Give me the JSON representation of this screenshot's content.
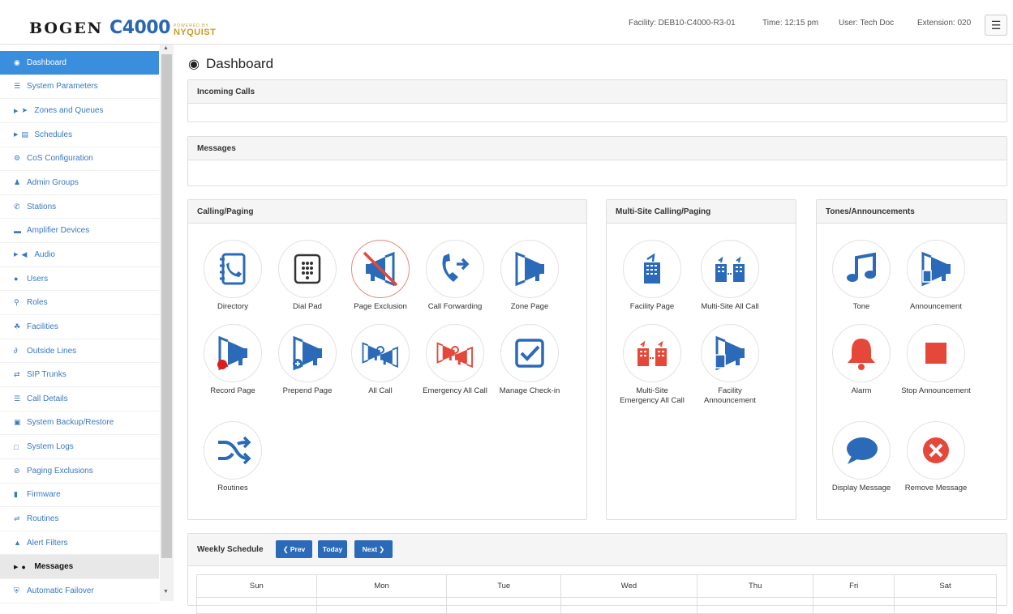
{
  "header": {
    "logo": {
      "brand": "BOGEN",
      "model": "C4000",
      "powered_by": "POWERED BY",
      "partner": "NYQUIST"
    },
    "facility": "Facility: DEB10-C4000-R3-01",
    "time": "Time: 12:15 pm",
    "user": "User: Tech Doc",
    "extension": "Extension: 020",
    "menu_icon": "hamburger-icon"
  },
  "sidebar": {
    "items": [
      {
        "label": "Dashboard",
        "icon": "dashboard-icon",
        "state": "active"
      },
      {
        "label": "System Parameters",
        "icon": "list-icon"
      },
      {
        "label": "Zones and Queues",
        "icon": "megaphone-icon",
        "caret": true
      },
      {
        "label": "Schedules",
        "icon": "calendar-icon",
        "caret": true
      },
      {
        "label": "CoS Configuration",
        "icon": "gears-icon"
      },
      {
        "label": "Admin Groups",
        "icon": "group-icon"
      },
      {
        "label": "Stations",
        "icon": "phone-icon"
      },
      {
        "label": "Amplifier Devices",
        "icon": "amplifier-icon"
      },
      {
        "label": "Audio",
        "icon": "volume-icon",
        "caret": true
      },
      {
        "label": "Users",
        "icon": "user-icon"
      },
      {
        "label": "Roles",
        "icon": "key-icon"
      },
      {
        "label": "Facilities",
        "icon": "sitemap-icon"
      },
      {
        "label": "Outside Lines",
        "icon": "trunk-icon"
      },
      {
        "label": "SIP Trunks",
        "icon": "exchange-icon"
      },
      {
        "label": "Call Details",
        "icon": "details-icon"
      },
      {
        "label": "System Backup/Restore",
        "icon": "database-icon"
      },
      {
        "label": "System Logs",
        "icon": "file-icon"
      },
      {
        "label": "Paging Exclusions",
        "icon": "ban-icon"
      },
      {
        "label": "Firmware",
        "icon": "chip-icon"
      },
      {
        "label": "Routines",
        "icon": "shuffle-icon"
      },
      {
        "label": "Alert Filters",
        "icon": "warning-icon"
      },
      {
        "label": "Messages",
        "icon": "comment-icon",
        "caret": true,
        "state": "open"
      },
      {
        "label": "Automatic Failover",
        "icon": "shield-icon"
      }
    ]
  },
  "main": {
    "title": "Dashboard",
    "incoming_calls": {
      "title": "Incoming Calls"
    },
    "messages": {
      "title": "Messages"
    },
    "calling_paging": {
      "title": "Calling/Paging",
      "tiles": [
        {
          "label": "Directory",
          "icon": "directory-icon"
        },
        {
          "label": "Dial Pad",
          "icon": "dialpad-icon"
        },
        {
          "label": "Page Exclusion",
          "icon": "page-exclusion-icon"
        },
        {
          "label": "Call Forwarding",
          "icon": "call-forwarding-icon"
        },
        {
          "label": "Zone Page",
          "icon": "zone-page-icon"
        },
        {
          "label": "Record Page",
          "icon": "record-page-icon"
        },
        {
          "label": "Prepend Page",
          "icon": "prepend-page-icon"
        },
        {
          "label": "All Call",
          "icon": "all-call-icon"
        },
        {
          "label": "Emergency All Call",
          "icon": "emergency-all-call-icon"
        },
        {
          "label": "Manage Check-in",
          "icon": "checkbox-icon"
        },
        {
          "label": "Routines",
          "icon": "shuffle-icon"
        }
      ]
    },
    "multisite": {
      "title": "Multi-Site Calling/Paging",
      "tiles": [
        {
          "label": "Facility Page",
          "icon": "facility-page-icon"
        },
        {
          "label": "Multi-Site All Call",
          "icon": "multisite-all-call-icon"
        },
        {
          "label": "Multi-Site Emergency All Call",
          "icon": "multisite-emergency-icon"
        },
        {
          "label": "Facility Announcement",
          "icon": "facility-announcement-icon"
        }
      ]
    },
    "tones": {
      "title": "Tones/Announcements",
      "tiles": [
        {
          "label": "Tone",
          "icon": "music-note-icon"
        },
        {
          "label": "Announcement",
          "icon": "announcement-icon"
        },
        {
          "label": "Alarm",
          "icon": "bell-icon"
        },
        {
          "label": "Stop Announcement",
          "icon": "stop-icon"
        },
        {
          "label": "Display Message",
          "icon": "speech-bubble-icon"
        },
        {
          "label": "Remove Message",
          "icon": "remove-icon"
        }
      ]
    },
    "weekly_schedule": {
      "title": "Weekly Schedule",
      "prev_label": "Prev",
      "today_label": "Today",
      "next_label": "Next",
      "days": [
        "Sun",
        "Mon",
        "Tue",
        "Wed",
        "Thu",
        "Fri",
        "Sat"
      ]
    }
  },
  "colors": {
    "accent": "#3a8ede",
    "icon_blue": "#2a6ab8",
    "alert_red": "#e5483a",
    "button_blue": "#2a6ab8"
  }
}
